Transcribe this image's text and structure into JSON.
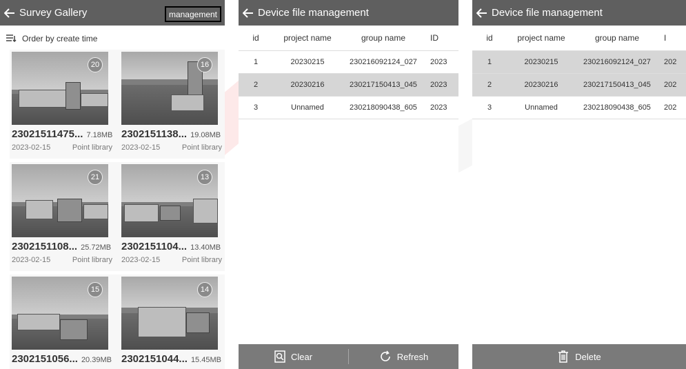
{
  "gallery": {
    "title": "Survey Gallery",
    "management_label": "management",
    "sort_label": "Order by create time",
    "items": [
      {
        "name": "23021511475...",
        "size": "7.18MB",
        "date": "2023-02-15",
        "source": "Point library",
        "count": "20"
      },
      {
        "name": "2302151138...",
        "size": "19.08MB",
        "date": "2023-02-15",
        "source": "Point library",
        "count": "16"
      },
      {
        "name": "2302151108...",
        "size": "25.72MB",
        "date": "2023-02-15",
        "source": "Point library",
        "count": "21"
      },
      {
        "name": "2302151104...",
        "size": "13.40MB",
        "date": "2023-02-15",
        "source": "Point library",
        "count": "13"
      },
      {
        "name": "2302151056...",
        "size": "20.39MB",
        "date": "",
        "source": "",
        "count": "15"
      },
      {
        "name": "2302151044...",
        "size": "15.45MB",
        "date": "",
        "source": "",
        "count": "14"
      }
    ]
  },
  "file_mgmt": {
    "title": "Device file management",
    "columns": {
      "id": "id",
      "project": "project name",
      "group": "group name",
      "extra_a": "ID",
      "extra_b": "I"
    },
    "rows": [
      {
        "id": "1",
        "project": "20230215",
        "group": "230216092124_027",
        "extra": "2023",
        "extra_short": "202"
      },
      {
        "id": "2",
        "project": "20230216",
        "group": "230217150413_045",
        "extra": "2023",
        "extra_short": "202"
      },
      {
        "id": "3",
        "project": "Unnamed",
        "group": "230218090438_605",
        "extra": "2023",
        "extra_short": "202"
      }
    ],
    "clear_label": "Clear",
    "refresh_label": "Refresh",
    "delete_label": "Delete"
  },
  "colors": {
    "appbar": "#5f5f5f",
    "bottombar": "#7a7a7a",
    "selected_row": "#d6d6d6",
    "highlight_border": "#000000"
  }
}
